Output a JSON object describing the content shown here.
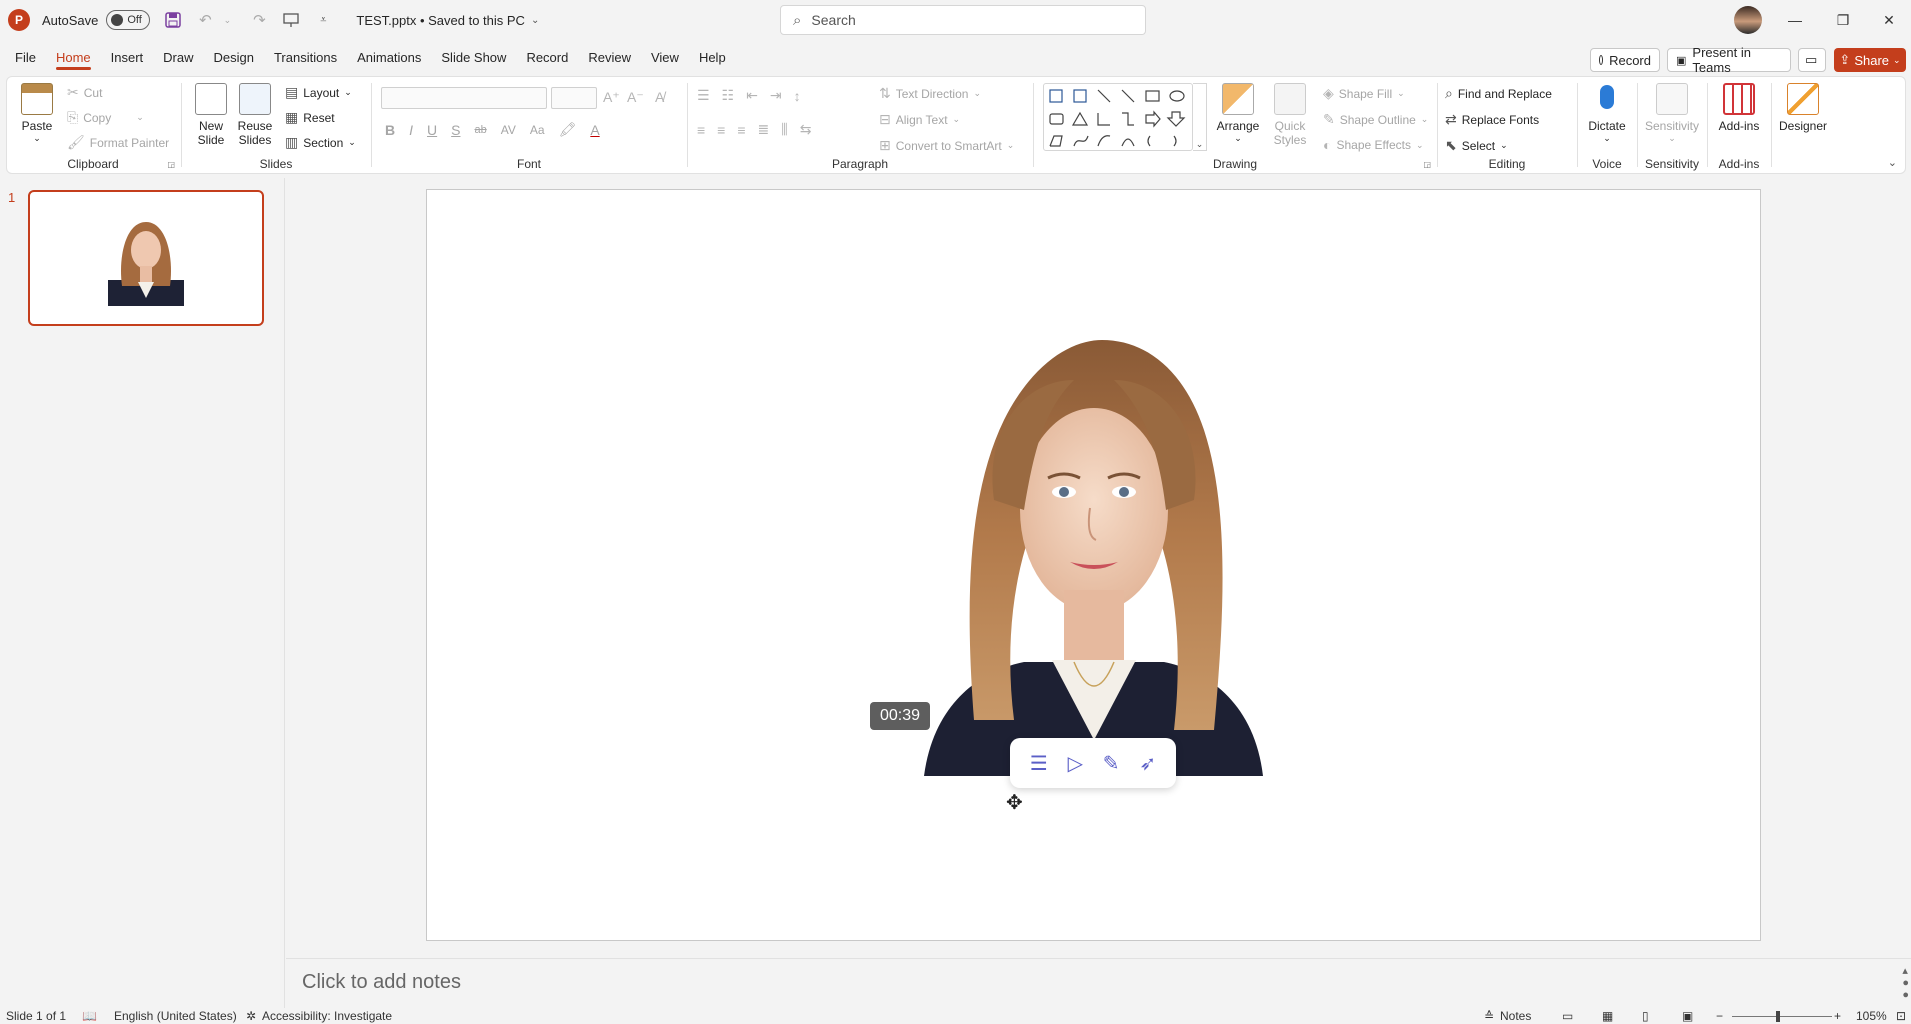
{
  "titlebar": {
    "app_logo": "P",
    "autosave_label": "AutoSave",
    "autosave_state": "Off",
    "filename": "TEST.pptx • Saved to this PC",
    "search_placeholder": "Search"
  },
  "menu": {
    "tabs": [
      "File",
      "Home",
      "Insert",
      "Draw",
      "Design",
      "Transitions",
      "Animations",
      "Slide Show",
      "Record",
      "Review",
      "View",
      "Help"
    ],
    "active_tab": "Home",
    "record_label": "Record",
    "present_teams_label": "Present in Teams",
    "share_label": "Share"
  },
  "ribbon": {
    "clipboard": {
      "label": "Clipboard",
      "paste": "Paste",
      "cut": "Cut",
      "copy": "Copy",
      "format_painter": "Format Painter"
    },
    "slides": {
      "label": "Slides",
      "new_slide_1": "New",
      "new_slide_2": "Slide",
      "reuse_1": "Reuse",
      "reuse_2": "Slides",
      "layout": "Layout",
      "reset": "Reset",
      "section": "Section"
    },
    "font": {
      "label": "Font",
      "bold": "B",
      "italic": "I",
      "underline": "U",
      "strike": "S",
      "strikethrough": "ab",
      "spacing": "AV",
      "case": "Aa"
    },
    "paragraph": {
      "label": "Paragraph",
      "text_direction": "Text Direction",
      "align_text": "Align Text",
      "convert_smartart": "Convert to SmartArt"
    },
    "drawing": {
      "label": "Drawing",
      "arrange": "Arrange",
      "quick_styles_1": "Quick",
      "quick_styles_2": "Styles",
      "shape_fill": "Shape Fill",
      "shape_outline": "Shape Outline",
      "shape_effects": "Shape Effects"
    },
    "editing": {
      "label": "Editing",
      "find_replace": "Find and Replace",
      "replace_fonts": "Replace Fonts",
      "select": "Select"
    },
    "voice": {
      "label": "Voice",
      "dictate": "Dictate"
    },
    "sensitivity": {
      "label": "Sensitivity",
      "button": "Sensitivity"
    },
    "addins": {
      "label": "Add-ins",
      "button": "Add-ins"
    },
    "designer": {
      "button": "Designer"
    }
  },
  "slides_pane": {
    "slide_number": "1"
  },
  "slide": {
    "video_time": "00:39"
  },
  "notes": {
    "placeholder": "Click to add notes"
  },
  "status": {
    "slide_count": "Slide 1 of 1",
    "language": "English (United States)",
    "accessibility": "Accessibility: Investigate",
    "notes": "Notes",
    "zoom": "105%"
  },
  "colors": {
    "accent": "#c43e1c",
    "float_icons": "#5b5fc7"
  }
}
